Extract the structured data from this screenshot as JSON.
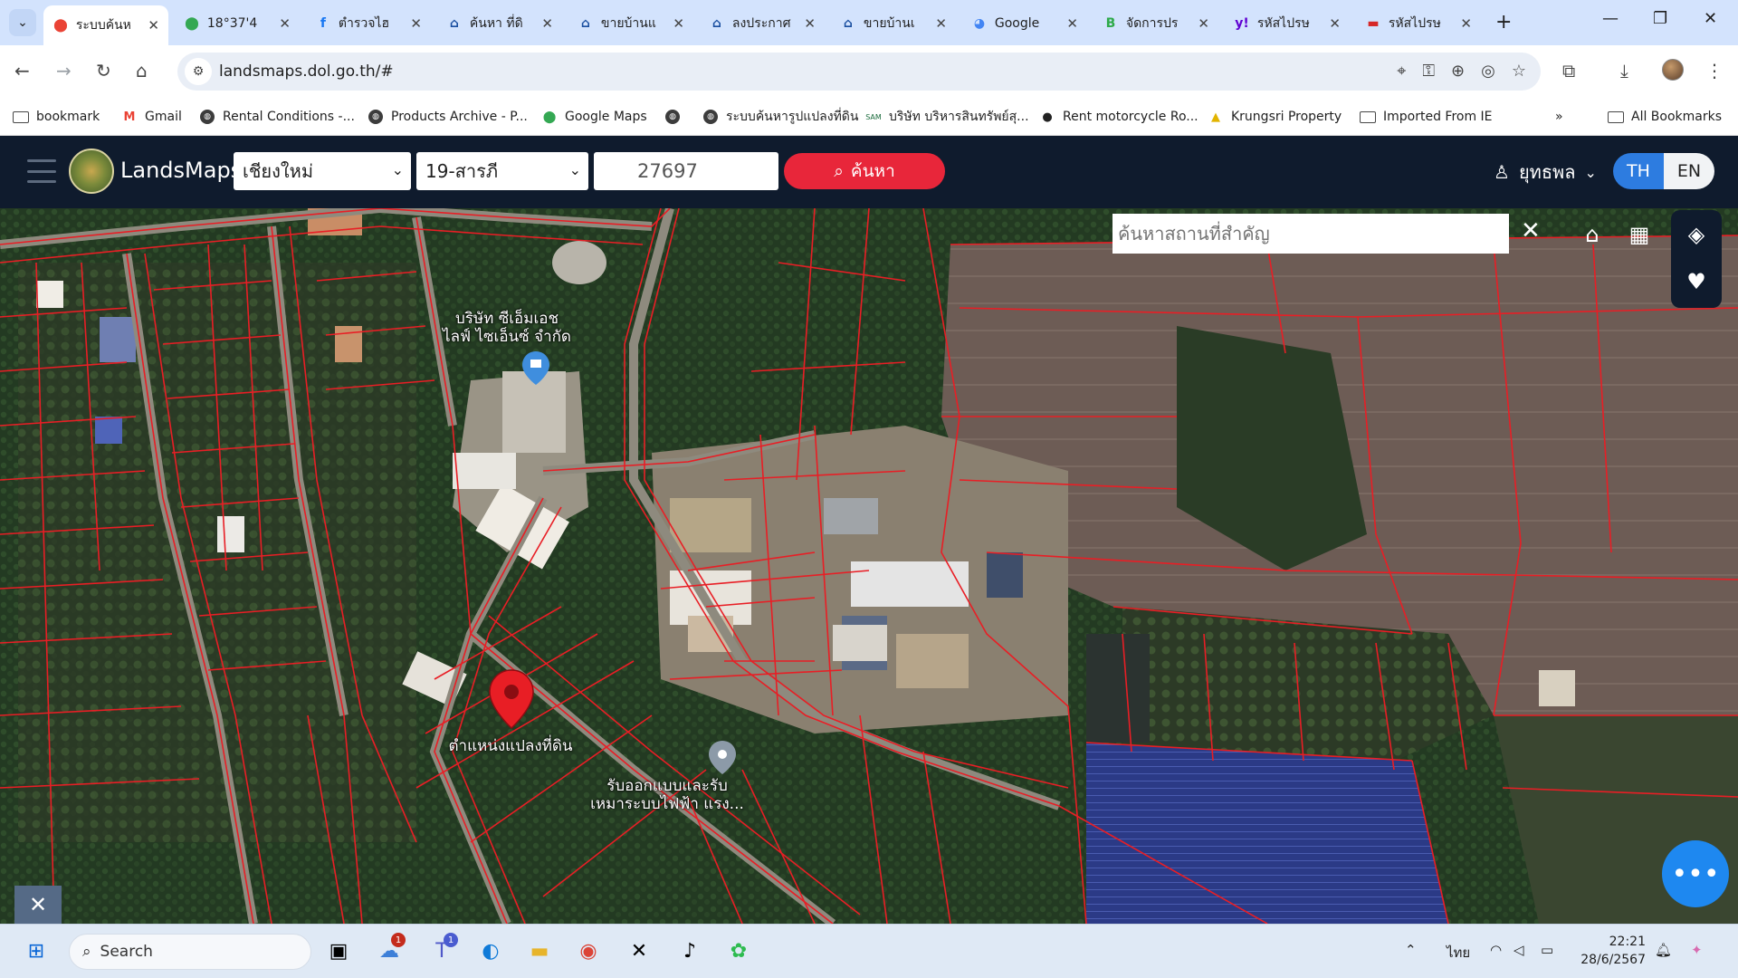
{
  "browser": {
    "tabs": [
      {
        "label": "ระบบค้นห",
        "icon": "google-maps-pin-icon",
        "color": "#ea4335",
        "active": true
      },
      {
        "label": "18°37'4",
        "icon": "google-maps-pin-icon",
        "color": "#34a853"
      },
      {
        "label": "ตำรวจไฮ",
        "icon": "facebook-icon",
        "color": "#1877f2"
      },
      {
        "label": "ค้นหา ที่ดิ",
        "icon": "house-icon",
        "color": "#1a4fa0"
      },
      {
        "label": "ขายบ้านแ",
        "icon": "house-icon",
        "color": "#1a4fa0"
      },
      {
        "label": "ลงประกาศ",
        "icon": "house-icon",
        "color": "#1a4fa0"
      },
      {
        "label": "ขายบ้านเ",
        "icon": "house-icon",
        "color": "#1a4fa0"
      },
      {
        "label": "Google ",
        "icon": "google-earth-icon",
        "color": "#4285f4"
      },
      {
        "label": "จัดการปร",
        "icon": "b-icon",
        "color": "#2eaa4a"
      },
      {
        "label": "รหัสไปรษ",
        "icon": "yahoo-icon",
        "color": "#6001d2"
      },
      {
        "label": "รหัสไปรษ",
        "icon": "flag-icon",
        "color": "#d62728"
      }
    ],
    "url": "landsmaps.dol.go.th/#",
    "bookmarks": [
      {
        "label": "bookmark",
        "icon": "folder-icon"
      },
      {
        "label": "Gmail",
        "icon": "gmail-icon"
      },
      {
        "label": "Rental Conditions -...",
        "icon": "globe-icon"
      },
      {
        "label": "Products Archive - P...",
        "icon": "globe-icon"
      },
      {
        "label": "Google Maps",
        "icon": "google-maps-pin-icon"
      },
      {
        "label": "",
        "icon": "globe-icon"
      },
      {
        "label": "ระบบค้นหารูปแปลงที่ดิน",
        "icon": "globe-icon"
      },
      {
        "label": "บริษัท บริหารสินทรัพย์สุ...",
        "icon": "sam-icon"
      },
      {
        "label": "Rent motorcycle Ro...",
        "icon": "motorcycle-icon"
      },
      {
        "label": "Krungsri Property",
        "icon": "krungsri-icon"
      },
      {
        "label": "Imported From IE",
        "icon": "folder-icon"
      }
    ],
    "all_bookmarks": "All Bookmarks"
  },
  "app": {
    "brand": "LandsMaps",
    "province": "เชียงใหม่",
    "district": "19-สารภี",
    "parcel_number": "27697",
    "search_label": "ค้นหา",
    "user_name": "ยุทธพล",
    "lang_th": "TH",
    "lang_en": "EN",
    "place_search_placeholder": "ค้นหาสถานที่สำคัญ",
    "accent_color": "#e8263a"
  },
  "map": {
    "labels": {
      "company": "บริษัท ซีเอ็มเอช\nไลฟ์ ไซเอ็นซ์ จำกัด",
      "parcel_position": "ตำแหน่งแปลงที่ดิน",
      "solar": "รับออกแบบและรับ\nเหมาระบบไฟฟ้า แรง..."
    }
  },
  "taskbar": {
    "search_label": "Search",
    "lang_indicator": "ไทย",
    "time": "22:21",
    "date": "28/6/2567",
    "badges": {
      "weather": "1",
      "teams": "1"
    }
  }
}
